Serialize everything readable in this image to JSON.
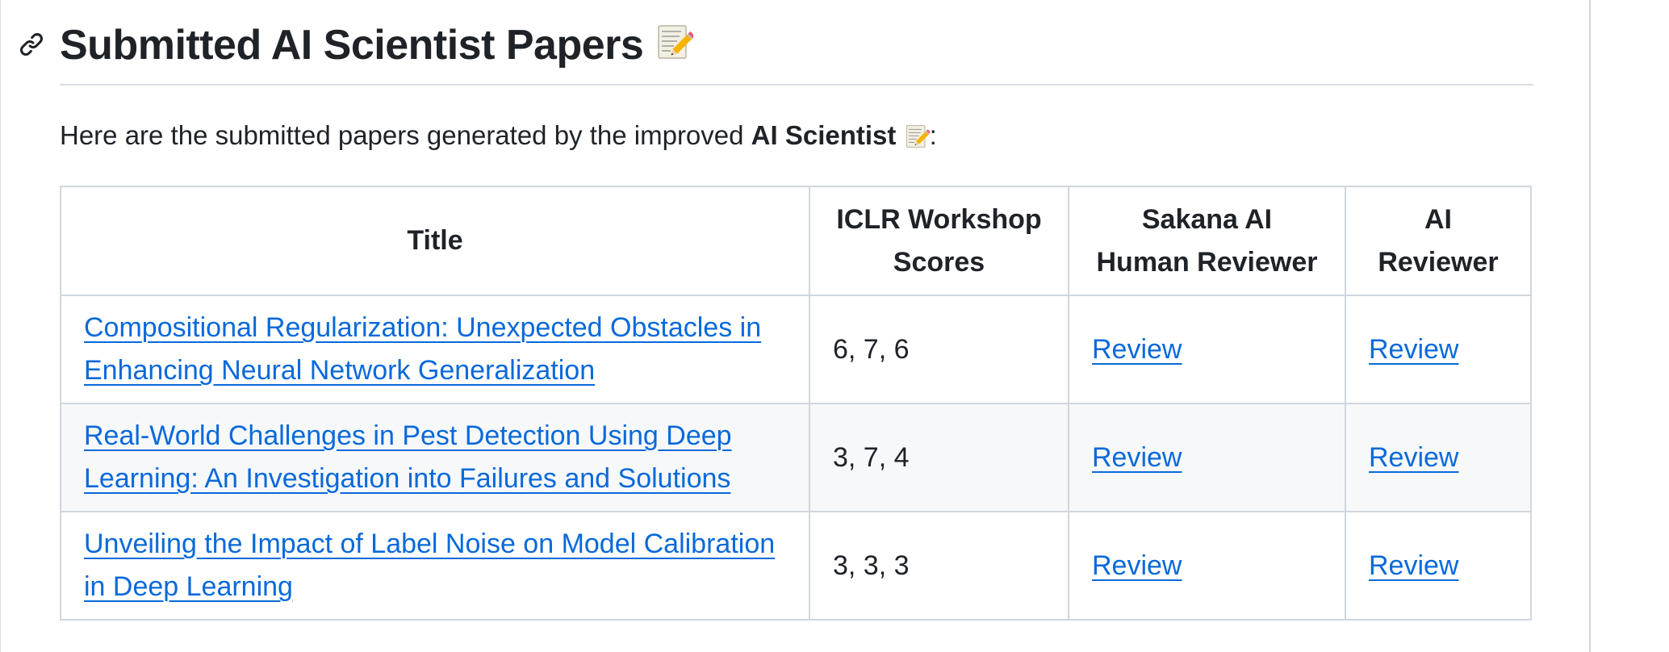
{
  "heading": {
    "title": "Submitted AI Scientist Papers",
    "emoji": "📝"
  },
  "intro": {
    "text_before": "Here are the submitted papers generated by the improved ",
    "bold": "AI Scientist",
    "emoji": "📝",
    "text_after": ":"
  },
  "table": {
    "headers": [
      "Title",
      "ICLR Workshop Scores",
      "Sakana AI Human Reviewer",
      "AI Reviewer"
    ],
    "rows": [
      {
        "title": "Compositional Regularization: Unexpected Obstacles in Enhancing Neural Network Generalization",
        "scores": "6, 7, 6",
        "human_review": "Review",
        "ai_review": "Review"
      },
      {
        "title": "Real-World Challenges in Pest Detection Using Deep Learning: An Investigation into Failures and Solutions",
        "scores": "3, 7, 4",
        "human_review": "Review",
        "ai_review": "Review"
      },
      {
        "title": "Unveiling the Impact of Label Noise on Model Calibration in Deep Learning",
        "scores": "3, 3, 3",
        "human_review": "Review",
        "ai_review": "Review"
      }
    ]
  },
  "colors": {
    "link": "#0969da",
    "text": "#1f2328",
    "border": "#d0d7de",
    "stripe": "#f6f8fa"
  },
  "icons": [
    "link-icon",
    "memo-icon"
  ]
}
